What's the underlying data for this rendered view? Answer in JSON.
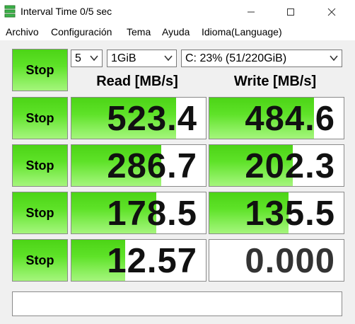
{
  "window": {
    "title": "Interval Time 0/5 sec",
    "app_icon": "disk-benchmark-icon",
    "controls": {
      "minimize": "minimize-icon",
      "maximize": "maximize-icon",
      "close": "close-icon"
    }
  },
  "menu": {
    "items": [
      "Archivo",
      "Configuración",
      "Tema",
      "Ayuda",
      "Idioma(Language)"
    ]
  },
  "controls": {
    "all_button": "Stop",
    "count": "5",
    "size": "1GiB",
    "drive": "C: 23% (51/220GiB)"
  },
  "headers": {
    "read": "Read [MB/s]",
    "write": "Write [MB/s]"
  },
  "rows": [
    {
      "button": "Stop",
      "read": "523.4",
      "write": "484.6",
      "read_fill": 0.78,
      "write_fill": 0.78
    },
    {
      "button": "Stop",
      "read": "286.7",
      "write": "202.3",
      "read_fill": 0.67,
      "write_fill": 0.62
    },
    {
      "button": "Stop",
      "read": "178.5",
      "write": "135.5",
      "read_fill": 0.63,
      "write_fill": 0.59
    },
    {
      "button": "Stop",
      "read": "12.57",
      "write": "0.000",
      "read_fill": 0.4,
      "write_fill": 0.0
    }
  ],
  "status": {
    "text": ""
  },
  "colors": {
    "accent_green": "#5ee228",
    "background": "#f0f0f0"
  }
}
